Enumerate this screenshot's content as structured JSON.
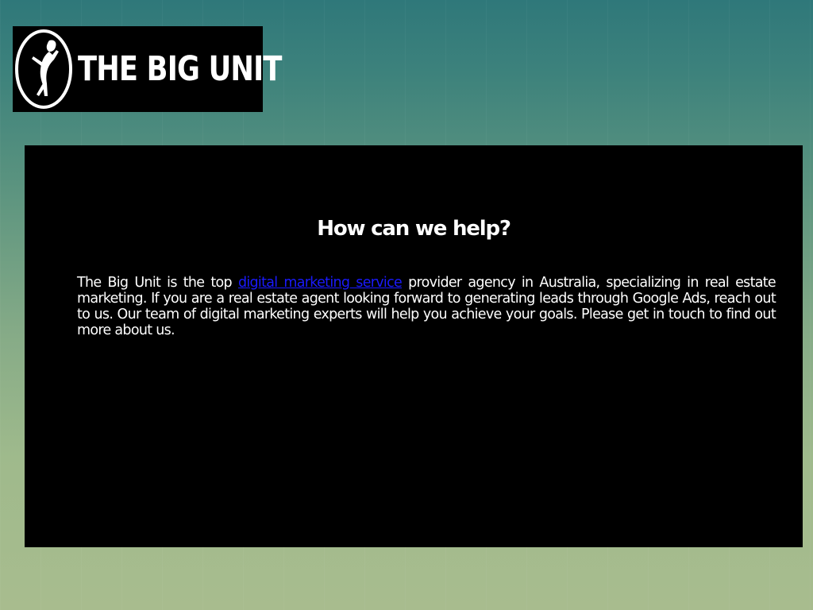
{
  "logo": {
    "text": "THE BIG UNIT",
    "icon": "climber-in-oval-icon"
  },
  "panel": {
    "heading": "How can we help?",
    "paragraph": {
      "before_link": "The Big Unit is the top ",
      "link_text": "digital marketing service",
      "after_link": " provider agency in Australia, specializing in real estate marketing. If you are a real estate agent looking forward to generating leads through Google Ads, reach out to us. Our team of digital marketing experts will help you achieve your goals. Please get in touch to find out more about us."
    }
  },
  "colors": {
    "background_top": "#2f787a",
    "background_bottom": "#a8bc8e",
    "panel": "#000000",
    "link": "#1a1aff",
    "text": "#ffffff"
  }
}
